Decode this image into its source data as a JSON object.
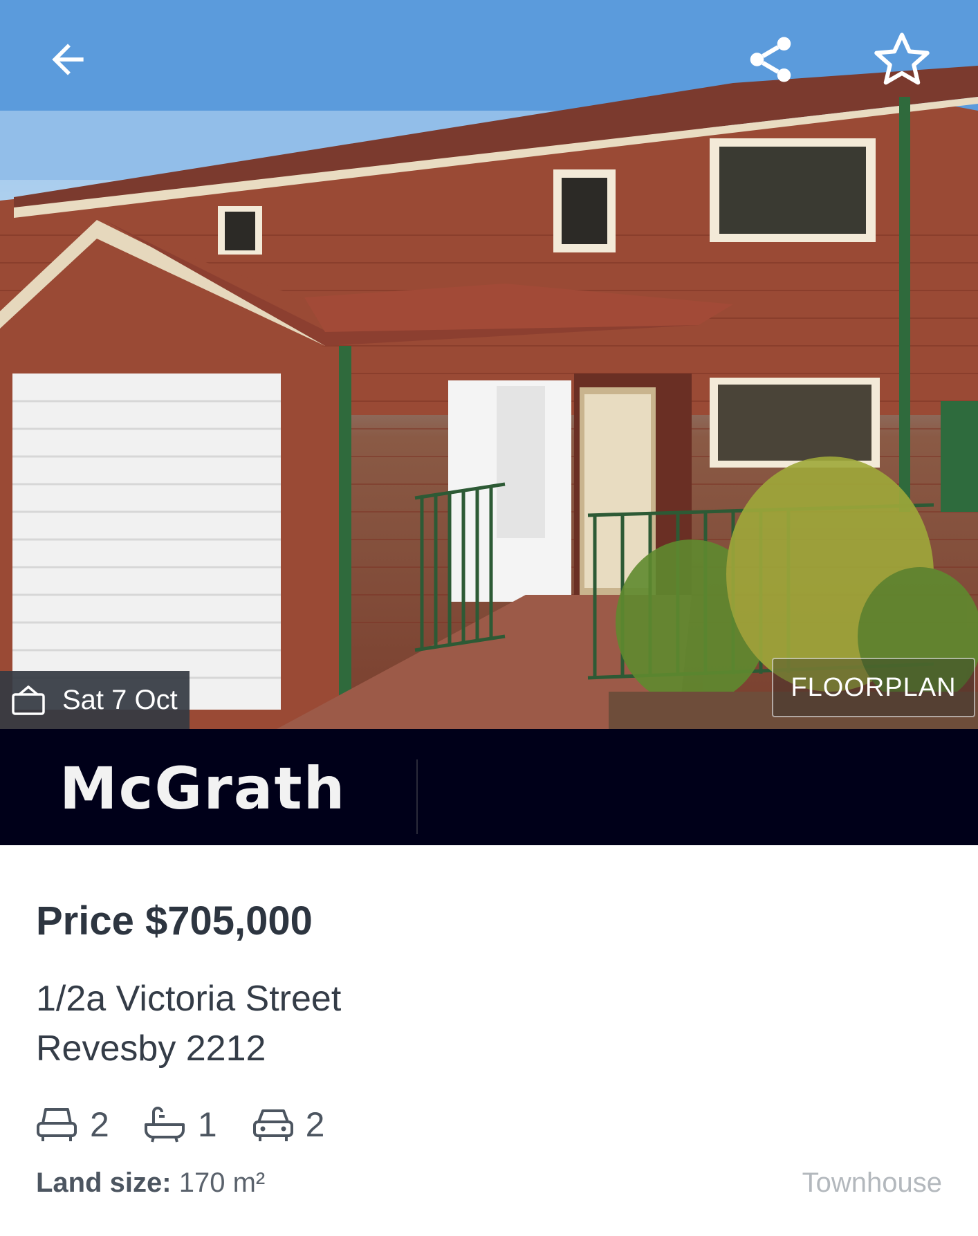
{
  "header": {
    "back_icon": "arrow-left-icon",
    "share_icon": "share-icon",
    "favourite_icon": "star-outline-icon"
  },
  "hero": {
    "inspection_icon": "open-house-icon",
    "inspection_date": "Sat 7 Oct",
    "floorplan_label": "FLOORPLAN"
  },
  "agency": {
    "logo_text": "McGrath",
    "background_color": "#000019"
  },
  "listing": {
    "price": "Price $705,000",
    "address_line1": "1/2a Victoria Street",
    "address_line2": "Revesby 2212",
    "bedrooms": "2",
    "bathrooms": "1",
    "car_spaces": "2",
    "land_label": "Land size:",
    "land_value": "170 m²",
    "property_type": "Townhouse"
  }
}
